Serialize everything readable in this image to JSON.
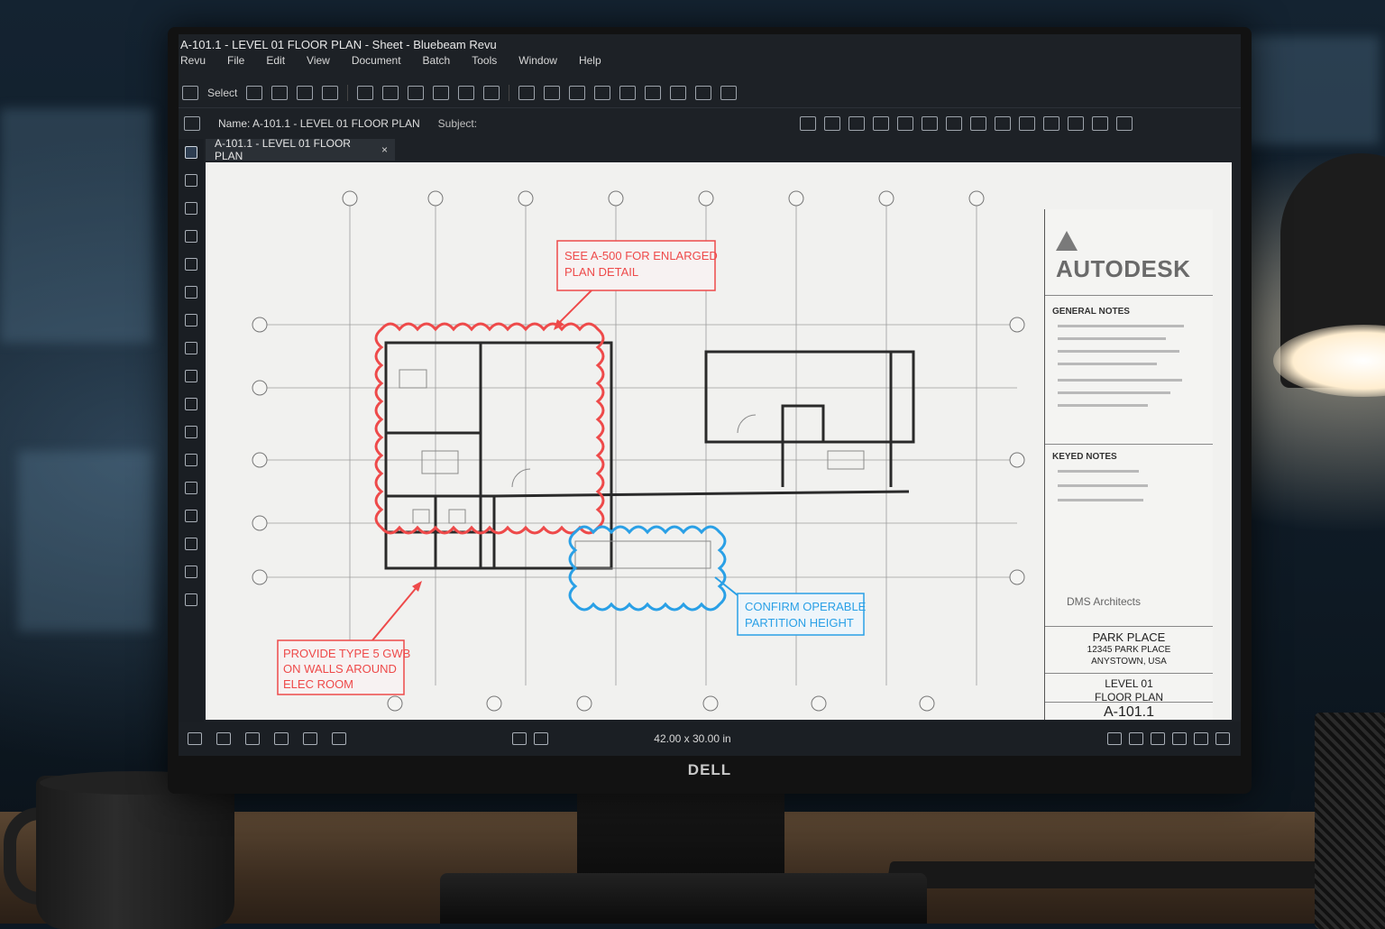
{
  "window": {
    "title": "A-101.1 - LEVEL 01 FLOOR PLAN - Sheet - Bluebeam Revu"
  },
  "menu": [
    "Revu",
    "File",
    "Edit",
    "View",
    "Document",
    "Batch",
    "Tools",
    "Window",
    "Help"
  ],
  "toolbar": {
    "select_label": "Select"
  },
  "properties": {
    "name_label": "Name: A-101.1 - LEVEL 01 FLOOR PLAN",
    "subject_label": "Subject:"
  },
  "tab": {
    "label": "A-101.1 - LEVEL 01 FLOOR PLAN",
    "close": "×"
  },
  "status": {
    "page_size": "42.00 x 30.00 in"
  },
  "monitor": {
    "brand": "DELL"
  },
  "markups": {
    "callout1": [
      "SEE A-500 FOR ENLARGED",
      "PLAN DETAIL"
    ],
    "callout2": [
      "PROVIDE TYPE 5 GWB",
      "ON WALLS AROUND",
      "ELEC ROOM"
    ],
    "callout3": [
      "CONFIRM OPERABLE",
      "PARTITION HEIGHT"
    ],
    "red_color": "#ee4a4a",
    "blue_color": "#2aa0e6"
  },
  "titleblock": {
    "logo": "AUTODESK",
    "general_notes": "GENERAL NOTES",
    "keyed_notes": "KEYED NOTES",
    "architect": "DMS Architects",
    "project": [
      "PARK PLACE",
      "12345 PARK PLACE",
      "ANYSTOWN, USA"
    ],
    "sheet_title": [
      "LEVEL 01",
      "FLOOR PLAN"
    ],
    "sheet_number": "A-101.1"
  }
}
